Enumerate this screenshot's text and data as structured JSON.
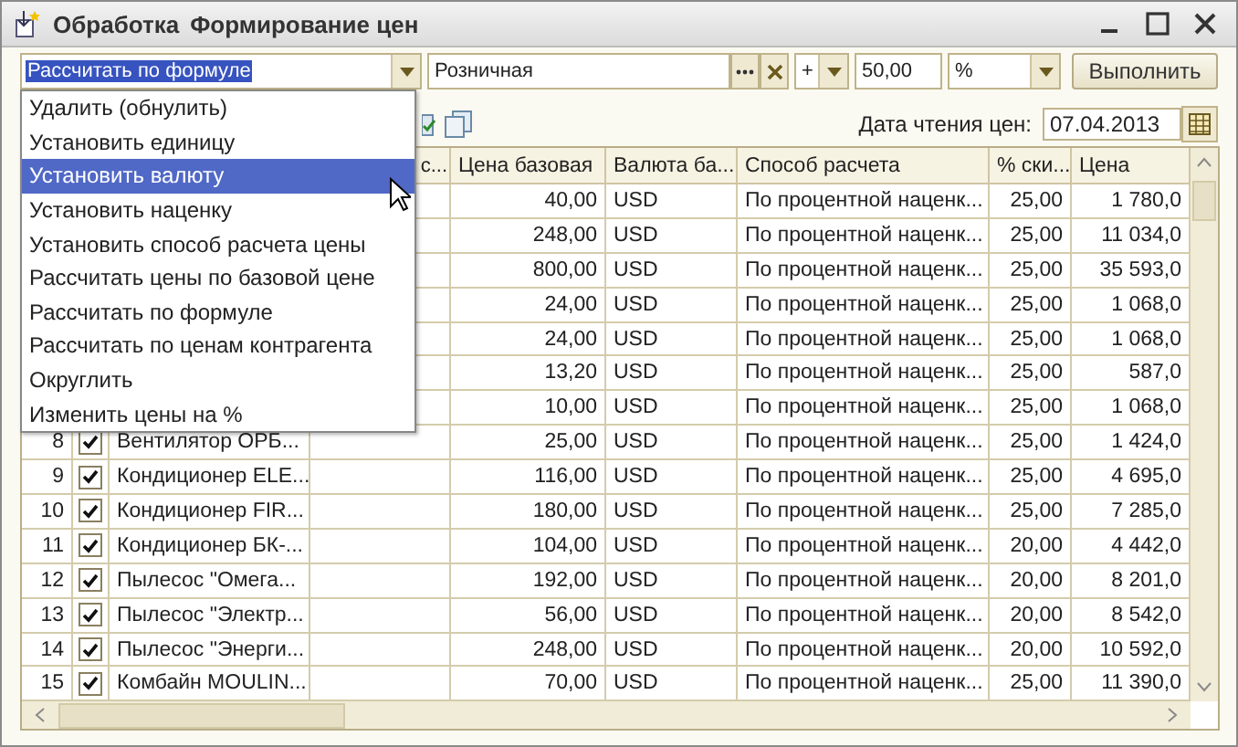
{
  "window": {
    "type_label": "Обработка",
    "title": "Формирование цен"
  },
  "controls": {
    "action": {
      "value": "Рассчитать по формуле",
      "highlighted": true
    },
    "price_type": "Розничная",
    "sign": "+",
    "amount": "50,00",
    "unit": "%",
    "execute_button": "Выполнить"
  },
  "dropdown": {
    "items": [
      {
        "label": "Удалить (обнулить)",
        "selected": false
      },
      {
        "label": "Установить единицу",
        "selected": false
      },
      {
        "label": "Установить валюту",
        "selected": true
      },
      {
        "label": "Установить наценку",
        "selected": false
      },
      {
        "label": "Установить способ расчета цены",
        "selected": false
      },
      {
        "label": "Рассчитать цены по базовой цене",
        "selected": false
      },
      {
        "label": "Рассчитать по формуле",
        "selected": false
      },
      {
        "label": "Рассчитать по ценам контрагента",
        "selected": false
      },
      {
        "label": "Округлить",
        "selected": false
      },
      {
        "label": "Изменить цены на %",
        "selected": false
      }
    ]
  },
  "date": {
    "label": "Дата чтения цен:",
    "value": "07.04.2013"
  },
  "table": {
    "columns": [
      "с...",
      "Цена базовая",
      "Валюта ба...",
      "Способ расчета",
      "% ски...",
      "Цена"
    ],
    "rows": [
      {
        "base_price": "40,00",
        "currency": "USD",
        "method": "По процентной наценк...",
        "discount": "25,00",
        "price": "1 780,0"
      },
      {
        "base_price": "248,00",
        "currency": "USD",
        "method": "По процентной наценк...",
        "discount": "25,00",
        "price": "11 034,0"
      },
      {
        "base_price": "800,00",
        "currency": "USD",
        "method": "По процентной наценк...",
        "discount": "25,00",
        "price": "35 593,0"
      },
      {
        "base_price": "24,00",
        "currency": "USD",
        "method": "По процентной наценк...",
        "discount": "25,00",
        "price": "1 068,0"
      },
      {
        "base_price": "24,00",
        "currency": "USD",
        "method": "По процентной наценк...",
        "discount": "25,00",
        "price": "1 068,0"
      },
      {
        "base_price": "13,20",
        "currency": "USD",
        "method": "По процентной наценк...",
        "discount": "25,00",
        "price": "587,0"
      },
      {
        "base_price": "10,00",
        "currency": "USD",
        "method": "По процентной наценк...",
        "discount": "25,00",
        "price": "1 068,0"
      },
      {
        "number": "8",
        "checked": true,
        "name": "Вентилятор ОРБ...",
        "base_price": "25,00",
        "currency": "USD",
        "method": "По процентной наценк...",
        "discount": "25,00",
        "price": "1 424,0"
      },
      {
        "number": "9",
        "checked": true,
        "name": "Кондиционер ELE...",
        "base_price": "116,00",
        "currency": "USD",
        "method": "По процентной наценк...",
        "discount": "25,00",
        "price": "4 695,0"
      },
      {
        "number": "10",
        "checked": true,
        "name": "Кондиционер FIR...",
        "base_price": "180,00",
        "currency": "USD",
        "method": "По процентной наценк...",
        "discount": "25,00",
        "price": "7 285,0"
      },
      {
        "number": "11",
        "checked": true,
        "name": "Кондиционер БК-...",
        "base_price": "104,00",
        "currency": "USD",
        "method": "По процентной наценк...",
        "discount": "20,00",
        "price": "4 442,0"
      },
      {
        "number": "12",
        "checked": true,
        "name": "Пылесос \"Омега...",
        "base_price": "192,00",
        "currency": "USD",
        "method": "По процентной наценк...",
        "discount": "20,00",
        "price": "8 201,0"
      },
      {
        "number": "13",
        "checked": true,
        "name": "Пылесос \"Электр...",
        "base_price": "56,00",
        "currency": "USD",
        "method": "По процентной наценк...",
        "discount": "20,00",
        "price": "8 542,0"
      },
      {
        "number": "14",
        "checked": true,
        "name": "Пылесос \"Энерги...",
        "base_price": "248,00",
        "currency": "USD",
        "method": "По процентной наценк...",
        "discount": "20,00",
        "price": "10 592,0"
      },
      {
        "number": "15",
        "checked": true,
        "name": "Комбайн MOULIN...",
        "base_price": "70,00",
        "currency": "USD",
        "method": "По процентной наценк...",
        "discount": "25,00",
        "price": "11 390,0"
      }
    ]
  }
}
